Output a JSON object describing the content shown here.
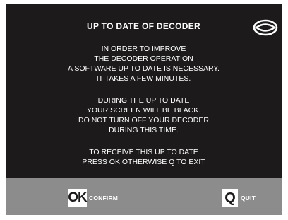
{
  "screen": {
    "title": "UP TO DATE OF DECODER",
    "logo_icon": "eye-logo-icon",
    "paragraphs": [
      {
        "lines": [
          "IN ORDER TO IMPROVE",
          "THE DECODER OPERATION",
          "A SOFTWARE UP TO DATE IS NECESSARY.",
          "IT TAKES A FEW MINUTES."
        ]
      },
      {
        "lines": [
          "DURING THE UP TO DATE",
          "YOUR SCREEN WILL BE BLACK.",
          "DO NOT TURN OFF YOUR DECODER",
          "DURING THIS TIME."
        ]
      },
      {
        "lines": [
          "TO RECEIVE THIS UP TO DATE",
          "PRESS OK OTHERWISE Q TO EXIT"
        ]
      }
    ]
  },
  "footer": {
    "ok_key": "OK",
    "confirm_label": "CONFIRM",
    "q_key": "Q",
    "quit_label": "QUIT"
  },
  "colors": {
    "background": "#1c1a1b",
    "footer": "#8d8c8d",
    "text": "#ffffff"
  }
}
